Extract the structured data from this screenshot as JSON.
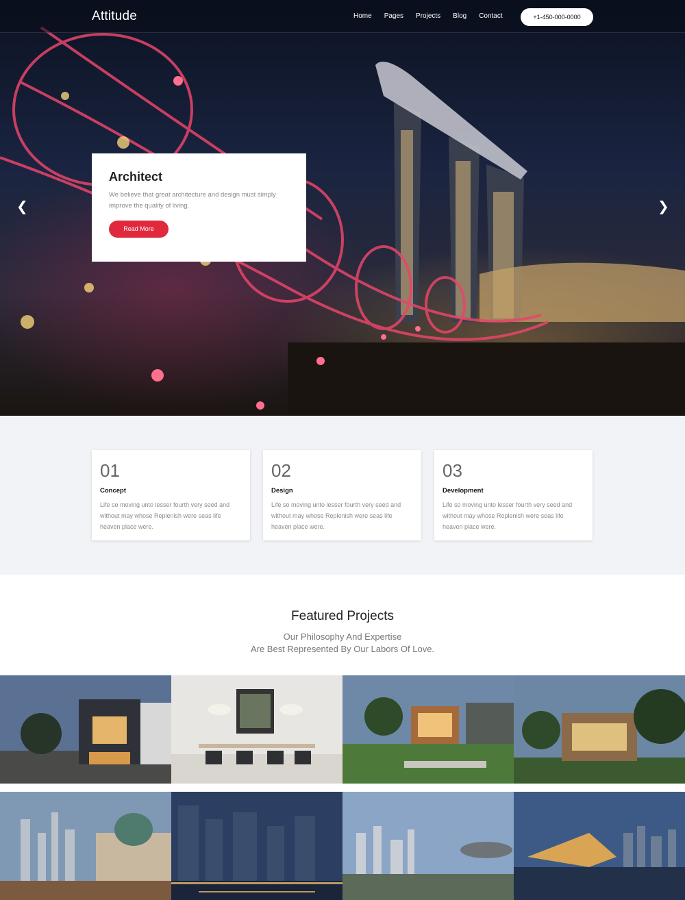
{
  "header": {
    "logo": "Attitude",
    "nav": [
      "Home",
      "Pages",
      "Projects",
      "Blog",
      "Contact"
    ],
    "phone": "+1-450-000-0000"
  },
  "hero": {
    "title": "Architect",
    "text": "We believe that great architecture and design must simply improve the quality of living.",
    "button": "Read More",
    "prev_icon": "chevron-left-icon",
    "next_icon": "chevron-right-icon"
  },
  "features": [
    {
      "number": "01",
      "title": "Concept",
      "text": "Life so moving unto lesser fourth very seed and without may whose Replenish were seas life heaven place were."
    },
    {
      "number": "02",
      "title": "Design",
      "text": "Life so moving unto lesser fourth very seed and without may whose Replenish were seas life heaven place were."
    },
    {
      "number": "03",
      "title": "Development",
      "text": "Life so moving unto lesser fourth very seed and without may whose Replenish were seas life heaven place were."
    }
  ],
  "projects": {
    "title": "Featured Projects",
    "subtitle_lines": [
      "Our Philosophy And Expertise",
      "Are Best Represented By Our Labors Of Love."
    ]
  },
  "colors": {
    "accent": "#e0293d",
    "features_bg": "#f1f3f6"
  }
}
